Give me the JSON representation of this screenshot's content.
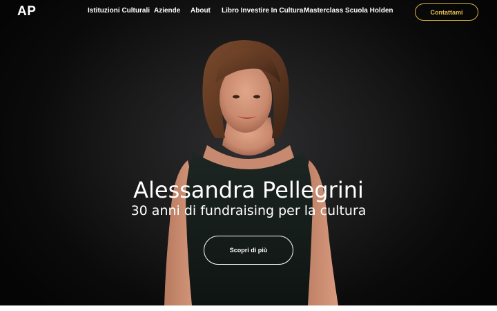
{
  "header": {
    "logo": "AP",
    "nav": [
      {
        "label": "Istituzioni Culturali"
      },
      {
        "label": "Aziende"
      },
      {
        "label": "About"
      },
      {
        "label": "Libro Investire In Cultura"
      },
      {
        "label": "Masterclass Scuola Holden"
      }
    ],
    "cta_label": "Contattami"
  },
  "hero": {
    "title": "Alessandra Pellegrini",
    "subtitle": "30 anni di fundraising per la cultura",
    "button_label": "Scopri di più"
  },
  "colors": {
    "background": "#0b0b0c",
    "accent": "#e8c04a",
    "text": "#ffffff"
  }
}
